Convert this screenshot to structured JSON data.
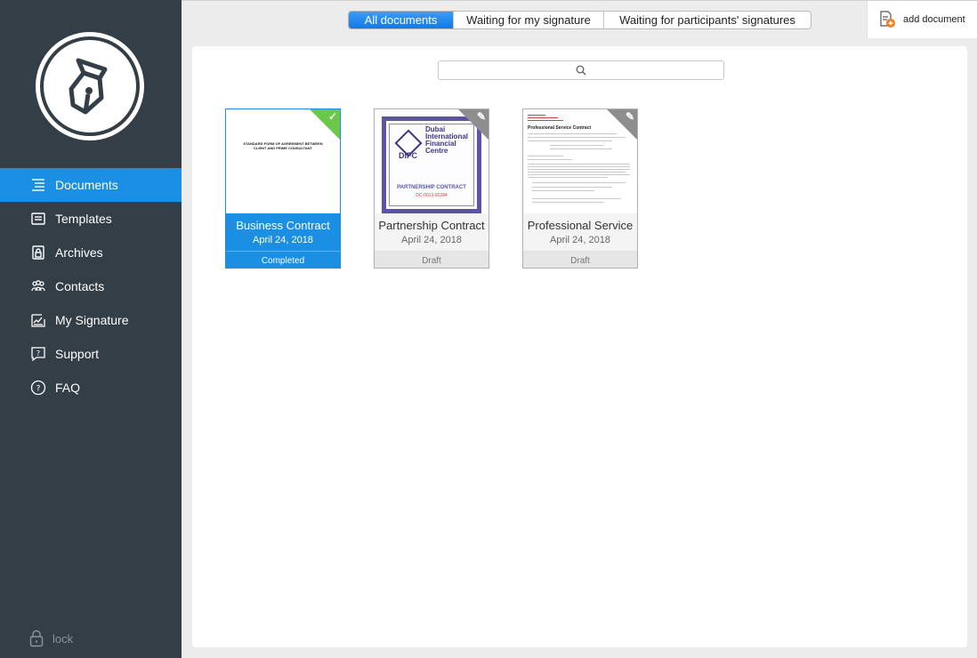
{
  "sidebar": {
    "logo_icon": "fountain-pen-nib-icon",
    "items": [
      {
        "label": "Documents",
        "icon": "list-lines-icon",
        "active": true
      },
      {
        "label": "Templates",
        "icon": "template-icon",
        "active": false
      },
      {
        "label": "Archives",
        "icon": "archive-lock-icon",
        "active": false
      },
      {
        "label": "Contacts",
        "icon": "people-icon",
        "active": false
      },
      {
        "label": "My Signature",
        "icon": "signature-icon",
        "active": false
      },
      {
        "label": "Support",
        "icon": "question-bubble-icon",
        "active": false
      },
      {
        "label": "FAQ",
        "icon": "question-circle-icon",
        "active": false
      }
    ],
    "lock_label": "lock"
  },
  "topbar": {
    "tabs": [
      {
        "label": "All documents",
        "active": true
      },
      {
        "label": "Waiting for my signature",
        "active": false
      },
      {
        "label": "Waiting for participants' signatures",
        "active": false
      }
    ],
    "add_document_label": "add document"
  },
  "search": {
    "icon": "search-icon"
  },
  "documents": [
    {
      "title": "Business Contract",
      "date": "April 24, 2018",
      "status": "Completed",
      "badge": "checkmark-icon",
      "preview_text": "STANDARD FORM OF AGREEMENT BETWEEN CLIENT AND PRIME CONSULTANT"
    },
    {
      "title": "Partnership Contract",
      "date": "April 24, 2018",
      "status": "Draft",
      "badge": "pencil-icon",
      "preview_org": "Dubai International Financial Centre",
      "preview_abbr": "DIFC",
      "preview_heading": "PARTNERSHIP CONTRACT",
      "preview_number": "DC-0013-60284"
    },
    {
      "title": "Professional Service",
      "date": "April 24, 2018",
      "status": "Draft",
      "badge": "pencil-icon",
      "preview_heading": "Professional Service Contract"
    }
  ],
  "colors": {
    "sidebar_bg": "#343e46",
    "accent": "#1a8fe3",
    "completed_badge": "#6bc84a",
    "draft_badge": "#8e8e8e"
  }
}
